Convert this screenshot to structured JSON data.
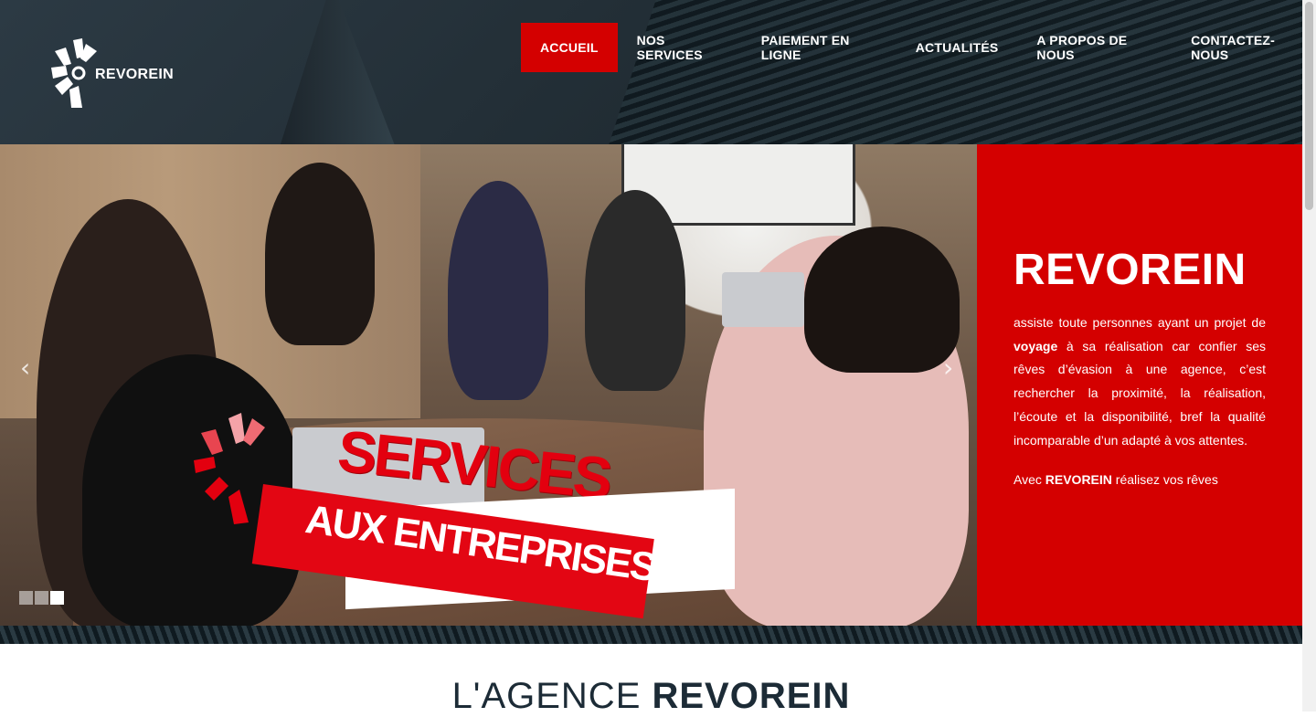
{
  "brand": {
    "name": "REVOREIN",
    "red": "#d40000",
    "dark": "#1c2b36"
  },
  "nav": {
    "items": [
      {
        "label": "ACCUEIL",
        "active": true
      },
      {
        "label": "NOS SERVICES",
        "active": false
      },
      {
        "label": "PAIEMENT EN LIGNE",
        "active": false
      },
      {
        "label": "ACTUALITÉS",
        "active": false
      },
      {
        "label": "A PROPOS DE NOUS",
        "active": false
      },
      {
        "label": "CONTACTEZ-NOUS",
        "active": false
      }
    ]
  },
  "slider": {
    "slogan_line1": "SERVICES",
    "slogan_line2": "AUX ENTREPRISES",
    "prev_icon": "chevron-left-icon",
    "next_icon": "chevron-right-icon",
    "slide_count": 3,
    "active_slide": 3
  },
  "info_panel": {
    "title": "REVOREIN",
    "p1_a": "assiste toute personnes ayant un projet de ",
    "p1_bold": "voyage",
    "p1_b": " à sa réalisation car confier ses rêves d’évasion à une agence, c’est rechercher la proximité, la réalisation, l’écoute et la disponibilité, bref la qualité incomparable d’un adapté à vos attentes.",
    "p2_a": "Avec ",
    "p2_bold": "REVOREIN",
    "p2_b": " réalisez vos rêves"
  },
  "section": {
    "title_light": "L'AGENCE ",
    "title_bold": "REVOREIN"
  }
}
